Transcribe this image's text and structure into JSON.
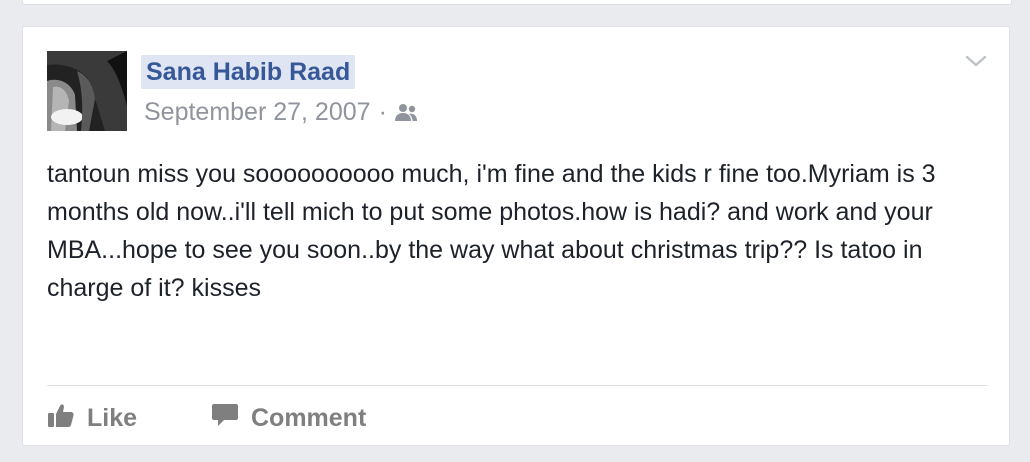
{
  "post": {
    "author": "Sana Habib Raad",
    "date": "September 27, 2007",
    "separator": "·",
    "privacy_icon": "friends-icon",
    "options_icon": "chevron-down-icon",
    "text": "tantoun miss you soooooooooo much, i'm fine and the kids r fine too.Myriam is 3 months old now..i'll tell mich to put some photos.how is hadi? and work and your MBA...hope to see you soon..by the way what about christmas trip?? Is tatoo in charge of it? kisses"
  },
  "actions": {
    "like_label": "Like",
    "like_icon": "thumbs-up-icon",
    "comment_label": "Comment",
    "comment_icon": "speech-bubble-icon"
  },
  "colors": {
    "page_background": "#e9ebee",
    "card_background": "#ffffff",
    "link_blue": "#365899",
    "name_highlight": "#dfe5f2",
    "meta_gray": "#90949c",
    "body_text": "#1d2129",
    "action_gray": "#7f7f7f"
  }
}
